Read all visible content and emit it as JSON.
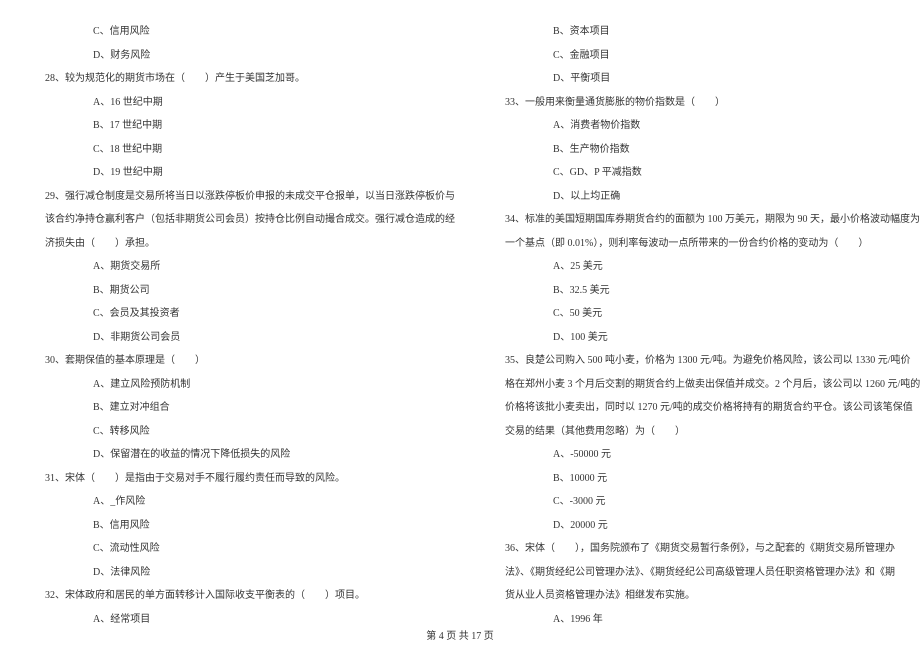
{
  "left": {
    "opt_c_27": "C、信用风险",
    "opt_d_27": "D、财务风险",
    "q28": "28、较为规范化的期货市场在（　　）产生于美国芝加哥。",
    "q28_a": "A、16 世纪中期",
    "q28_b": "B、17 世纪中期",
    "q28_c": "C、18 世纪中期",
    "q28_d": "D、19 世纪中期",
    "q29_l1": "29、强行减仓制度是交易所将当日以涨跌停板价申报的未成交平仓报单，以当日涨跌停板价与",
    "q29_l2": "该合约净持仓赢利客户（包括非期货公司会员）按持仓比例自动撮合成交。强行减仓造成的经",
    "q29_l3": "济损失由（　　）承担。",
    "q29_a": "A、期货交易所",
    "q29_b": "B、期货公司",
    "q29_c": "C、会员及其投资者",
    "q29_d": "D、非期货公司会员",
    "q30": "30、套期保值的基本原理是（　　）",
    "q30_a": "A、建立风险预防机制",
    "q30_b": "B、建立对冲组合",
    "q30_c": "C、转移风险",
    "q30_d": "D、保留潜在的收益的情况下降低损失的风险",
    "q31": "31、宋体（　　）是指由于交易对手不履行履约责任而导致的风险。",
    "q31_a": "A、_作风险",
    "q31_b": "B、信用风险",
    "q31_c": "C、流动性风险",
    "q31_d": "D、法律风险",
    "q32": "32、宋体政府和居民的单方面转移计入国际收支平衡表的（　　）项目。",
    "q32_a": "A、经常项目"
  },
  "right": {
    "q32_b": "B、资本项目",
    "q32_c": "C、金融项目",
    "q32_d": "D、平衡项目",
    "q33": "33、一般用来衡量通货膨胀的物价指数是（　　）",
    "q33_a": "A、消费者物价指数",
    "q33_b": "B、生产物价指数",
    "q33_c": "C、GD、P 平减指数",
    "q33_d": "D、以上均正确",
    "q34_l1": "34、标准的美国短期国库券期货合约的面额为 100 万美元，期限为 90 天，最小价格波动幅度为",
    "q34_l2": "一个基点（即 0.01%），则利率每波动一点所带来的一份合约价格的变动为（　　）",
    "q34_a": "A、25 美元",
    "q34_b": "B、32.5 美元",
    "q34_c": "C、50 美元",
    "q34_d": "D、100 美元",
    "q35_l1": "35、良楚公司购入 500 吨小麦，价格为 1300 元/吨。为避免价格风险，该公司以 1330 元/吨价",
    "q35_l2": "格在郑州小麦 3 个月后交割的期货合约上做卖出保值并成交。2 个月后，该公司以 1260 元/吨的",
    "q35_l3": "价格将该批小麦卖出，同时以 1270 元/吨的成交价格将持有的期货合约平仓。该公司该笔保值",
    "q35_l4": "交易的结果（其他费用忽略）为（　　）",
    "q35_a": "A、-50000 元",
    "q35_b": "B、10000 元",
    "q35_c": "C、-3000 元",
    "q35_d": "D、20000 元",
    "q36_l1": "36、宋体（　　），国务院颁布了《期货交易暂行条例》，与之配套的《期货交易所管理办",
    "q36_l2": "法》、《期货经纪公司管理办法》、《期货经纪公司高级管理人员任职资格管理办法》和《期",
    "q36_l3": "货从业人员资格管理办法》相继发布实施。",
    "q36_a": "A、1996 年"
  },
  "footer": "第 4 页 共 17 页"
}
